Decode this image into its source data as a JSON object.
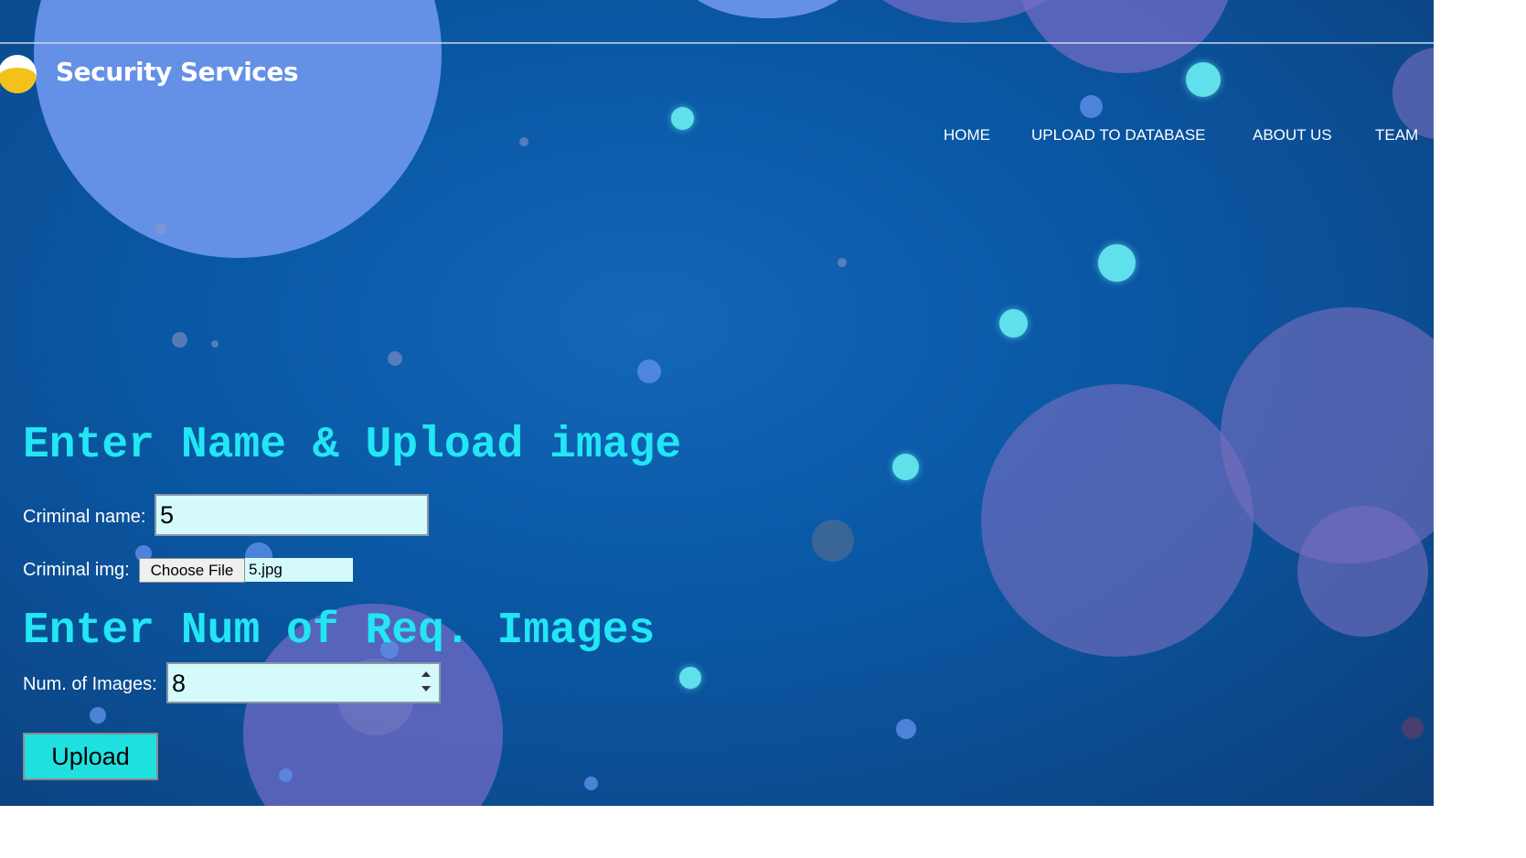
{
  "brand": {
    "name": "Security Services"
  },
  "nav": {
    "items": [
      "HOME",
      "UPLOAD TO DATABASE",
      "ABOUT US",
      "TEAM"
    ]
  },
  "form": {
    "heading_upload": "Enter Name & Upload image",
    "criminal_name_label": "Criminal name:",
    "criminal_name_value": "5",
    "criminal_img_label": "Criminal img:",
    "choose_file_label": "Choose File",
    "chosen_file_name": "5.jpg",
    "heading_num": "Enter Num of Req. Images",
    "num_images_label": "Num. of Images:",
    "num_images_value": "8",
    "upload_label": "Upload"
  },
  "colors": {
    "heading": "#22e6f4",
    "input_bg": "#d5fafb",
    "upload_button": "#20e0e0",
    "logo_yellow": "#f2c21a"
  }
}
